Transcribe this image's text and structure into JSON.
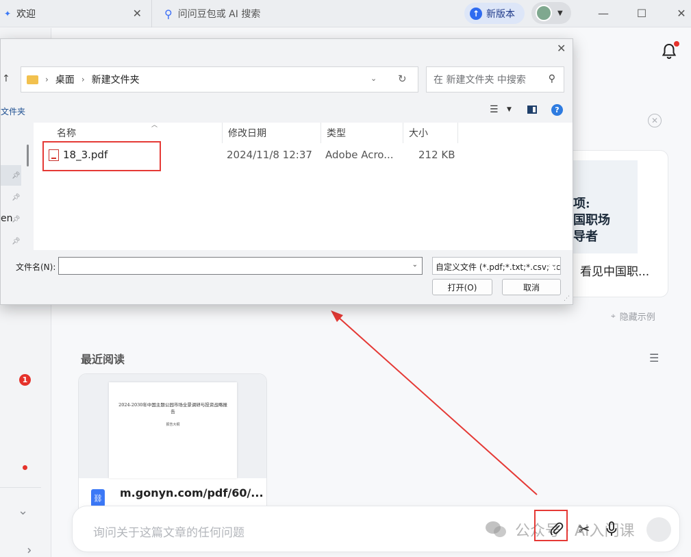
{
  "tabs": {
    "welcome_label": "欢迎",
    "search_label": "问问豆包或 AI 搜索"
  },
  "header": {
    "new_version_label": "新版本"
  },
  "sidebar": {
    "badge_count": "1"
  },
  "examples": {
    "card_title": "看见中国职...",
    "card_thumb_text": "项:\n国职场\n导者",
    "hide_label": "隐藏示例"
  },
  "recent": {
    "section_title": "最近阅读",
    "items": [
      {
        "page_title": "2024-2030年中国主题公园市场全景调研与投资战略报告",
        "page_subtitle": "报告大纲",
        "url": "m.gonyn.com/pdf/60/..."
      }
    ]
  },
  "ask": {
    "placeholder": "询问关于这篇文章的任何问题",
    "watermark": "公众号 · AI入门课"
  },
  "dialog": {
    "breadcrumbs": [
      "桌面",
      "新建文件夹"
    ],
    "search_placeholder": "在 新建文件夹 中搜索",
    "new_folder_label": "文件夹",
    "nav_partial_label": "en",
    "columns": [
      "名称",
      "修改日期",
      "类型",
      "大小"
    ],
    "files": [
      {
        "name": "18_3.pdf",
        "date": "2024/11/8 12:37",
        "type": "Adobe Acro...",
        "size": "212 KB"
      }
    ],
    "filename_label": "文件名(N):",
    "filename_value": "",
    "filter_value": "自定义文件 (*.pdf;*.txt;*.csv;*.c",
    "open_label": "打开(O)",
    "cancel_label": "取消"
  },
  "colors": {
    "accent": "#2f6bf0",
    "annotation_red": "#e53935",
    "badge_red": "#e5322b"
  }
}
